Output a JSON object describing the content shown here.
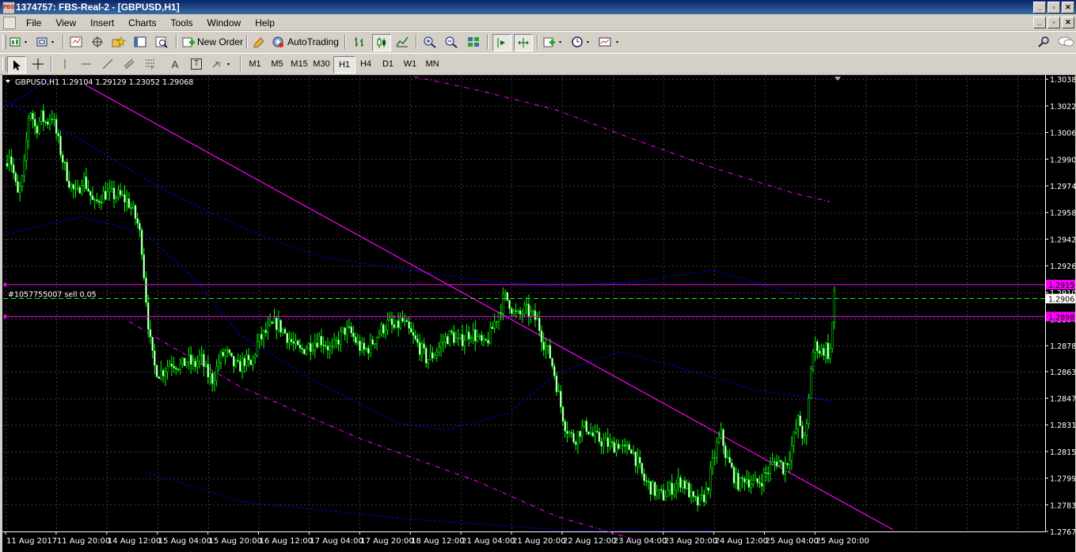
{
  "window": {
    "app_icon_label": "FBS",
    "title": "1374757: FBS-Real-2 - [GBPUSD,H1]"
  },
  "menu": {
    "items": [
      "File",
      "View",
      "Insert",
      "Charts",
      "Tools",
      "Window",
      "Help"
    ]
  },
  "toolbar": {
    "new_order_label": "New Order",
    "autotrading_label": "AutoTrading"
  },
  "drawing_tools": {
    "text_tool_label": "A",
    "text_label_tool_label": "T"
  },
  "timeframes": [
    "M1",
    "M5",
    "M15",
    "M30",
    "H1",
    "H4",
    "D1",
    "W1",
    "MN"
  ],
  "active_timeframe": "H1",
  "colors": {
    "background": "#000000",
    "grid": "#3a3a3a",
    "candle": "#00ff00",
    "bullish_body": "#000000",
    "bearish_body": "#ffffff",
    "trendline": "#ff00ff",
    "channel": "#0000ff",
    "bid_line": "#00ff00",
    "axis_text": "#ffffff",
    "magenta_label_bg": "#ff00ff"
  },
  "chart_data": {
    "type": "candlestick",
    "symbol": "GBPUSD",
    "timeframe": "H1",
    "info_line": "GBPUSD,H1  1.29104 1.29129 1.23052 1.29068",
    "order_label": "#1057755007 sell 0.05",
    "ylim": [
      1.2767,
      1.304
    ],
    "y_ticks": [
      "1.30385",
      "1.30225",
      "1.30065",
      "1.29905",
      "1.29745",
      "1.29585",
      "1.29425",
      "1.29265",
      "1.29105",
      "1.28945",
      "1.28785",
      "1.28630",
      "1.28470",
      "1.28310",
      "1.28150",
      "1.27990",
      "1.27830",
      "1.27670"
    ],
    "x_ticks": [
      "11 Aug 2017",
      "11 Aug 20:00",
      "14 Aug 12:00",
      "15 Aug 04:00",
      "15 Aug 20:00",
      "16 Aug 12:00",
      "17 Aug 04:00",
      "17 Aug 20:00",
      "18 Aug 12:00",
      "21 Aug 04:00",
      "21 Aug 20:00",
      "22 Aug 12:00",
      "23 Aug 04:00",
      "23 Aug 20:00",
      "24 Aug 12:00",
      "25 Aug 04:00",
      "25 Aug 20:00"
    ],
    "current_price": "1.29068",
    "current_price_value": 1.29068,
    "stop_loss": "1.29152",
    "stop_loss_value": 1.29152,
    "take_profit": "1.28980",
    "take_profit_value": 1.2896,
    "grid": true,
    "close_path": [
      [
        0,
        1.2988
      ],
      [
        5,
        1.2995
      ],
      [
        10,
        1.2982
      ],
      [
        15,
        1.2968
      ],
      [
        20,
        1.2975
      ],
      [
        25,
        1.299
      ],
      [
        28,
        1.3015
      ],
      [
        32,
        1.302
      ],
      [
        38,
        1.3008
      ],
      [
        45,
        1.3016
      ],
      [
        52,
        1.3012
      ],
      [
        58,
        1.3018
      ],
      [
        62,
        1.301
      ],
      [
        68,
        1.2998
      ],
      [
        75,
        1.2985
      ],
      [
        82,
        1.2975
      ],
      [
        90,
        1.2968
      ],
      [
        97,
        1.298
      ],
      [
        105,
        1.2972
      ],
      [
        112,
        1.2962
      ],
      [
        118,
        1.2967
      ],
      [
        125,
        1.297
      ],
      [
        135,
        1.2969
      ],
      [
        145,
        1.2968
      ],
      [
        155,
        1.2965
      ],
      [
        162,
        1.2958
      ],
      [
        168,
        1.295
      ],
      [
        172,
        1.2938
      ],
      [
        176,
        1.2915
      ],
      [
        180,
        1.2893
      ],
      [
        184,
        1.2875
      ],
      [
        188,
        1.2866
      ],
      [
        194,
        1.2862
      ],
      [
        200,
        1.2864
      ],
      [
        208,
        1.2869
      ],
      [
        215,
        1.2868
      ],
      [
        222,
        1.2866
      ],
      [
        230,
        1.287
      ],
      [
        238,
        1.2866
      ],
      [
        246,
        1.2872
      ],
      [
        254,
        1.2862
      ],
      [
        262,
        1.2858
      ],
      [
        270,
        1.287
      ],
      [
        278,
        1.2875
      ],
      [
        286,
        1.2868
      ],
      [
        294,
        1.2865
      ],
      [
        302,
        1.287
      ],
      [
        310,
        1.2866
      ],
      [
        318,
        1.288
      ],
      [
        326,
        1.2885
      ],
      [
        334,
        1.2889
      ],
      [
        342,
        1.2892
      ],
      [
        350,
        1.2888
      ],
      [
        358,
        1.2883
      ],
      [
        365,
        1.2878
      ],
      [
        372,
        1.2875
      ],
      [
        380,
        1.2878
      ],
      [
        388,
        1.288
      ],
      [
        396,
        1.2883
      ],
      [
        404,
        1.288
      ],
      [
        412,
        1.2875
      ],
      [
        420,
        1.2882
      ],
      [
        428,
        1.2888
      ],
      [
        436,
        1.2886
      ],
      [
        444,
        1.288
      ],
      [
        452,
        1.2875
      ],
      [
        460,
        1.2878
      ],
      [
        468,
        1.2884
      ],
      [
        476,
        1.2889
      ],
      [
        484,
        1.2892
      ],
      [
        492,
        1.2888
      ],
      [
        500,
        1.2894
      ],
      [
        508,
        1.2888
      ],
      [
        516,
        1.2882
      ],
      [
        524,
        1.2877
      ],
      [
        532,
        1.287
      ],
      [
        540,
        1.2873
      ],
      [
        548,
        1.2878
      ],
      [
        556,
        1.2883
      ],
      [
        564,
        1.2885
      ],
      [
        572,
        1.288
      ],
      [
        580,
        1.2884
      ],
      [
        588,
        1.2887
      ],
      [
        596,
        1.2883
      ],
      [
        604,
        1.2878
      ],
      [
        612,
        1.2885
      ],
      [
        618,
        1.2893
      ],
      [
        624,
        1.29
      ],
      [
        630,
        1.2908
      ],
      [
        636,
        1.2905
      ],
      [
        642,
        1.2898
      ],
      [
        648,
        1.2896
      ],
      [
        656,
        1.29
      ],
      [
        664,
        1.2897
      ],
      [
        672,
        1.2893
      ],
      [
        680,
        1.288
      ],
      [
        688,
        1.2872
      ],
      [
        694,
        1.286
      ],
      [
        700,
        1.2845
      ],
      [
        706,
        1.2832
      ],
      [
        712,
        1.2826
      ],
      [
        718,
        1.2822
      ],
      [
        726,
        1.2828
      ],
      [
        734,
        1.283
      ],
      [
        742,
        1.2824
      ],
      [
        750,
        1.2822
      ],
      [
        758,
        1.282
      ],
      [
        766,
        1.2818
      ],
      [
        774,
        1.282
      ],
      [
        782,
        1.2815
      ],
      [
        790,
        1.2818
      ],
      [
        798,
        1.2808
      ],
      [
        806,
        1.2798
      ],
      [
        814,
        1.2794
      ],
      [
        822,
        1.279
      ],
      [
        830,
        1.2788
      ],
      [
        838,
        1.2792
      ],
      [
        846,
        1.2795
      ],
      [
        854,
        1.2798
      ],
      [
        862,
        1.2792
      ],
      [
        868,
        1.2785
      ],
      [
        874,
        1.2784
      ],
      [
        880,
        1.2786
      ],
      [
        886,
        1.2792
      ],
      [
        892,
        1.2805
      ],
      [
        898,
        1.2818
      ],
      [
        904,
        1.2825
      ],
      [
        910,
        1.2812
      ],
      [
        916,
        1.2805
      ],
      [
        922,
        1.2798
      ],
      [
        928,
        1.2795
      ],
      [
        934,
        1.28
      ],
      [
        940,
        1.2797
      ],
      [
        946,
        1.2795
      ],
      [
        952,
        1.2797
      ],
      [
        958,
        1.28
      ],
      [
        964,
        1.2804
      ],
      [
        970,
        1.2808
      ],
      [
        976,
        1.281
      ],
      [
        982,
        1.2805
      ],
      [
        988,
        1.281
      ],
      [
        994,
        1.282
      ],
      [
        998,
        1.2828
      ],
      [
        1002,
        1.2835
      ],
      [
        1006,
        1.2826
      ],
      [
        1010,
        1.282
      ],
      [
        1014,
        1.284
      ],
      [
        1016,
        1.2862
      ],
      [
        1020,
        1.2875
      ],
      [
        1024,
        1.288
      ],
      [
        1028,
        1.2876
      ],
      [
        1032,
        1.2875
      ],
      [
        1036,
        1.2878
      ],
      [
        1040,
        1.2872
      ],
      [
        1043,
        1.288
      ],
      [
        1046,
        1.291
      ],
      [
        1048,
        1.2905
      ]
    ]
  }
}
